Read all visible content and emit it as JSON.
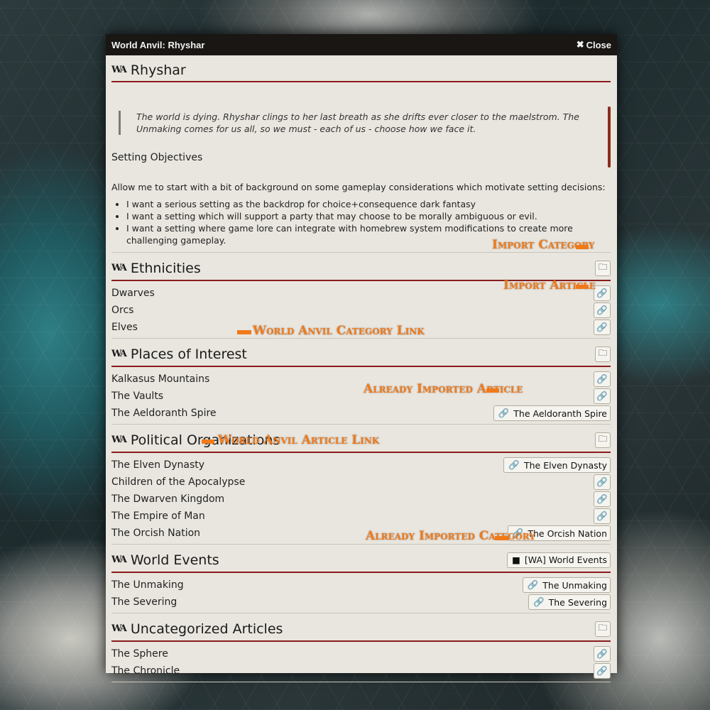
{
  "window": {
    "title": "World Anvil: Rhyshar",
    "close_label": "Close"
  },
  "world": {
    "title": "Rhyshar",
    "quote": "The world is dying. Rhyshar clings to her last breath as she drifts ever closer to the maelstrom. The Unmaking comes for us all, so we must - each of us - choose how we face it.",
    "objectives_heading": "Setting Objectives",
    "background_intro": "Allow me to start with a bit of background on some gameplay considerations which motivate setting decisions:",
    "bullets": [
      "I want a serious setting as the backdrop for choice+consequence dark fantasy",
      "I want a setting which will support a party that may choose to be morally ambiguous or evil.",
      "I want a setting where game lore can integrate with homebrew system modifications to create more challenging gameplay."
    ]
  },
  "sections": {
    "ethnicities": {
      "title": "Ethnicities",
      "items": [
        "Dwarves",
        "Orcs",
        "Elves"
      ]
    },
    "places": {
      "title": "Places of Interest",
      "items": [
        "Kalkasus Mountains",
        "The Vaults",
        "The Aeldoranth Spire"
      ],
      "imported": "The Aeldoranth Spire"
    },
    "political": {
      "title": "Political Organizations",
      "items": [
        "The Elven Dynasty",
        "Children of the Apocalypse",
        "The Dwarven Kingdom",
        "The Empire of Man",
        "The Orcish Nation"
      ],
      "imported_0": "The Elven Dynasty",
      "imported_4": "The Orcish Nation"
    },
    "events": {
      "title": "World Events",
      "category_imported": "[WA] World Events",
      "items": [
        "The Unmaking",
        "The Severing"
      ],
      "imported_0": "The Unmaking",
      "imported_1": "The Severing"
    },
    "uncategorized": {
      "title": "Uncategorized Articles",
      "items": [
        "The Sphere",
        "The Chronicle"
      ]
    }
  },
  "annotations": {
    "import_category": "Import Category",
    "import_article": "Import Article",
    "category_link": "World Anvil Category Link",
    "already_imported_article": "Already Imported Article",
    "article_link": "World Anvil Article Link",
    "already_imported_category": "Already Imported Category"
  },
  "icons": {
    "wa": "world-anvil-icon",
    "link": "link-icon",
    "folder_plus": "folder-plus-icon",
    "folder": "folder-icon",
    "close": "close-icon"
  },
  "colors": {
    "accent": "#8a1c1c",
    "annotation": "#f07a1a",
    "titlebar": "#191613",
    "panel": "#e9e6df"
  }
}
